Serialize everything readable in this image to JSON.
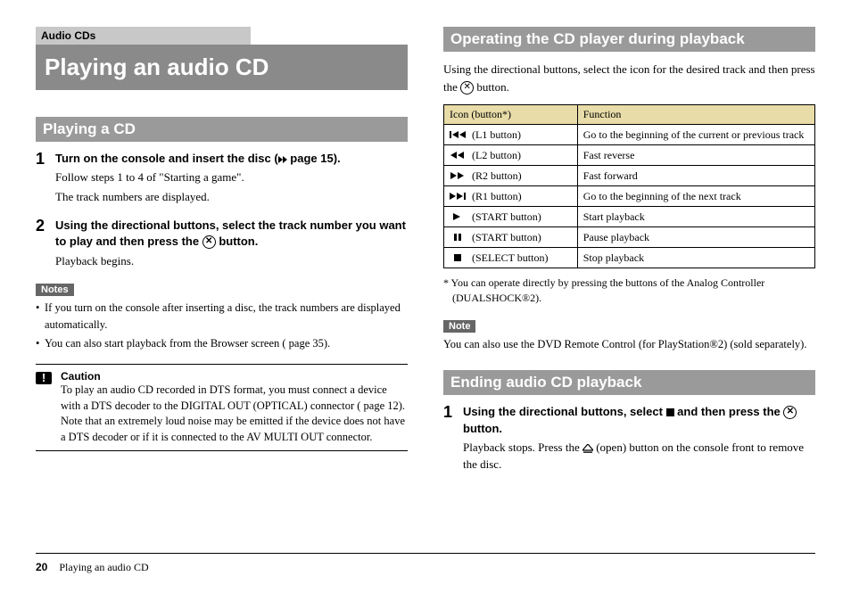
{
  "chapterLabel": "Audio CDs",
  "mainTitle": "Playing an audio CD",
  "left": {
    "section1": {
      "title": "Playing a CD",
      "steps": [
        {
          "num": "1",
          "heading_a": "Turn on the console and insert the disc (",
          "heading_b": " page 15).",
          "text1": "Follow steps 1 to 4 of \"Starting a game\".",
          "text2": "The track numbers are displayed."
        },
        {
          "num": "2",
          "heading_a": "Using the directional buttons, select the track number you want to play and then press the ",
          "heading_b": " button.",
          "text1": "Playback begins."
        }
      ],
      "notesLabel": "Notes",
      "notes": [
        "If you turn on the console after inserting a disc, the track numbers are displayed automatically.",
        "You can also start playback from the Browser screen (  page 35)."
      ],
      "cautionTitle": "Caution",
      "cautionText": "To play an audio CD recorded in DTS format, you must connect a device with a DTS decoder to the DIGITAL OUT (OPTICAL) connector (  page 12). Note that an extremely loud noise may be emitted if the device does not have a DTS decoder or if it is connected to the AV MULTI OUT connector."
    }
  },
  "right": {
    "section2": {
      "title": "Operating the CD player during playback",
      "intro_a": "Using the directional buttons, select the icon for the desired track and then press the ",
      "intro_b": " button.",
      "tableHeader1": "Icon  (button*)",
      "tableHeader2": "Function",
      "rows": [
        {
          "btn": "(L1 button)",
          "func": "Go to the beginning of the current or previous track"
        },
        {
          "btn": "(L2 button)",
          "func": "Fast reverse"
        },
        {
          "btn": "(R2 button)",
          "func": "Fast forward"
        },
        {
          "btn": "(R1 button)",
          "func": "Go to the beginning of the next track"
        },
        {
          "btn": "(START button)",
          "func": "Start playback"
        },
        {
          "btn": "(START button)",
          "func": "Pause playback"
        },
        {
          "btn": "(SELECT button)",
          "func": "Stop playback"
        }
      ],
      "footnote": "*  You can operate directly by pressing the buttons of the Analog Controller (DUALSHOCK®2).",
      "noteLabel": "Note",
      "noteBody": "You can also use the DVD Remote Control (for PlayStation®2) (sold separately)."
    },
    "section3": {
      "title": "Ending audio CD playback",
      "step": {
        "num": "1",
        "heading_a": "Using the directional buttons, select ",
        "heading_b": " and then press the ",
        "heading_c": " button.",
        "text_a": "Playback stops. Press the ",
        "text_b": " (open) button on the console front to remove the disc."
      }
    }
  },
  "footer": {
    "page": "20",
    "title": "Playing an audio CD"
  }
}
